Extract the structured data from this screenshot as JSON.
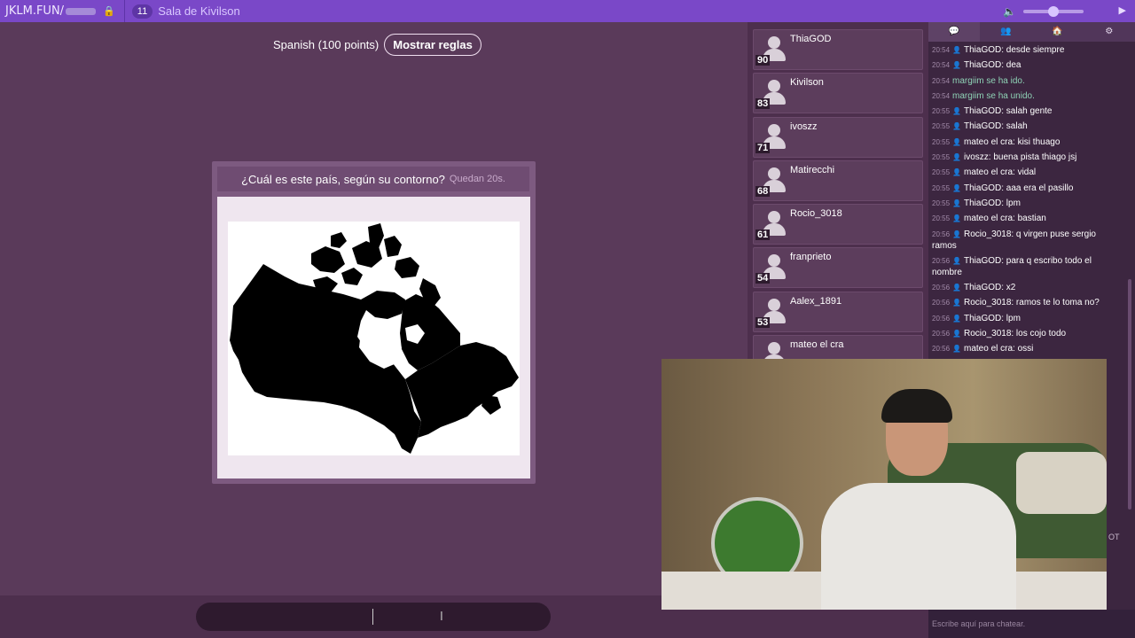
{
  "topbar": {
    "site": "JKLM.FUN/",
    "room_count": "11",
    "room_name": "Sala de Kivilson"
  },
  "game": {
    "language": "Spanish (100 points)",
    "rules_button": "Mostrar reglas",
    "question": "¿Cuál es este país, según su contorno?",
    "timer": "Quedan 20s."
  },
  "players": [
    {
      "name": "ThiaGOD",
      "score": "90"
    },
    {
      "name": "Kivilson",
      "score": "83"
    },
    {
      "name": "ivoszz",
      "score": "71"
    },
    {
      "name": "Matirecchi",
      "score": "68"
    },
    {
      "name": "Rocio_3018",
      "score": "61"
    },
    {
      "name": "franprieto",
      "score": "54"
    },
    {
      "name": "Aalex_1891",
      "score": "53"
    },
    {
      "name": "mateo el cra",
      "score": ""
    }
  ],
  "chat": {
    "tabs": [
      "💬",
      "👥",
      "🏠",
      "⚙"
    ],
    "placeholder": "Escribe aquí para chatear.",
    "side_text": "OT",
    "messages": [
      {
        "time": "20:54",
        "user": "ThiaGOD",
        "text": "desde siempre"
      },
      {
        "time": "20:54",
        "user": "ThiaGOD",
        "text": "dea"
      },
      {
        "time": "20:54",
        "system": "margiim se ha ido."
      },
      {
        "time": "20:54",
        "system": "margiim se ha unido."
      },
      {
        "time": "20:55",
        "user": "ThiaGOD",
        "text": "salah gente"
      },
      {
        "time": "20:55",
        "user": "ThiaGOD",
        "text": "salah"
      },
      {
        "time": "20:55",
        "user": "mateo el cra",
        "text": "kisi thuago"
      },
      {
        "time": "20:55",
        "user": "ivoszz",
        "text": "buena pista thiago jsj"
      },
      {
        "time": "20:55",
        "user": "mateo el cra",
        "text": "vidal"
      },
      {
        "time": "20:55",
        "user": "ThiaGOD",
        "text": "aaa era el pasillo"
      },
      {
        "time": "20:55",
        "user": "ThiaGOD",
        "text": "lpm"
      },
      {
        "time": "20:55",
        "user": "mateo el cra",
        "text": "bastian"
      },
      {
        "time": "20:56",
        "user": "Rocio_3018",
        "text": "q virgen puse sergio ramos"
      },
      {
        "time": "20:56",
        "user": "ThiaGOD",
        "text": "para q escribo todo el nombre"
      },
      {
        "time": "20:56",
        "user": "ThiaGOD",
        "text": "x2"
      },
      {
        "time": "20:56",
        "user": "Rocio_3018",
        "text": "ramos te lo toma no?"
      },
      {
        "time": "20:56",
        "user": "ThiaGOD",
        "text": "lpm"
      },
      {
        "time": "20:56",
        "user": "Rocio_3018",
        "text": "los cojo todo"
      },
      {
        "time": "20:56",
        "user": "mateo el cra",
        "text": "ossi"
      }
    ]
  },
  "colors": {
    "topbar": "#7a48c8",
    "background": "#5a3a5a",
    "system_message": "#8fd3b6"
  }
}
